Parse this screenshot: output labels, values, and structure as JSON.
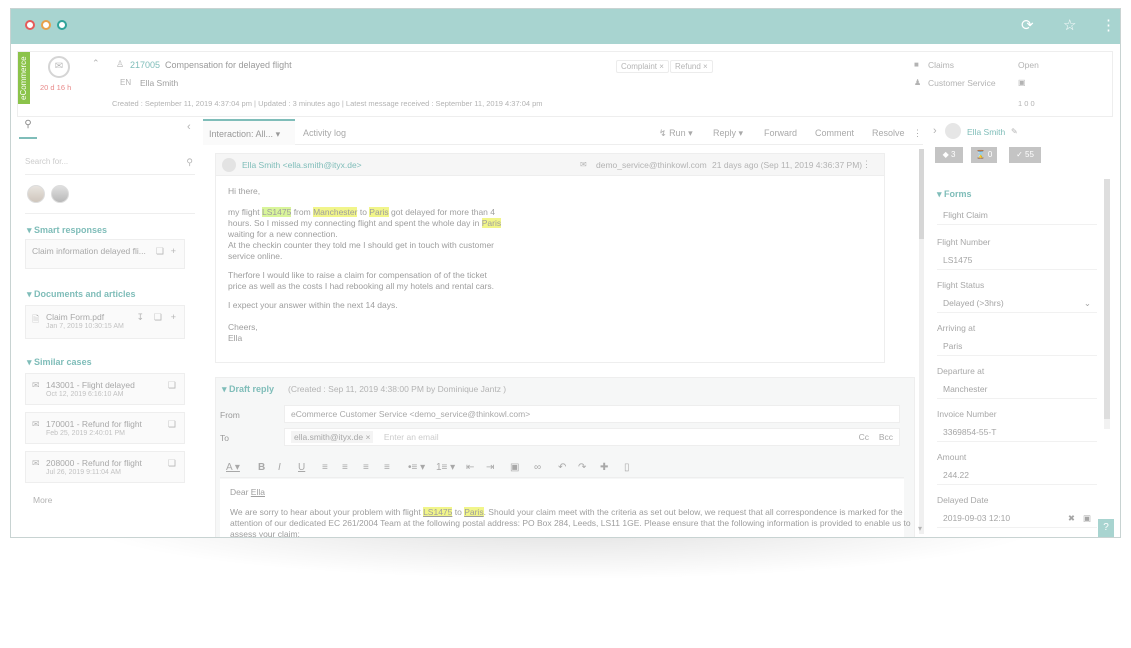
{
  "header": {
    "ecommerce_label": "eCommerce",
    "sla_time": "20 d 16 h",
    "case_id": "217005",
    "case_title": "Compensation for delayed flight",
    "lang": "EN",
    "customer": "Ella Smith",
    "tags": [
      "Complaint",
      "Refund"
    ],
    "meta": "Created : September 11, 2019 4:37:04 pm  |  Updated : 3 minutes ago  |  Latest message received : September 11, 2019 4:37:04 pm",
    "category": "Claims",
    "team": "Customer Service",
    "status": "Open",
    "counts": "1  0  0"
  },
  "left": {
    "search_placeholder": "Search for...",
    "smart_title": "Smart responses",
    "smart_item": "Claim information delayed fli...",
    "docs_title": "Documents and articles",
    "doc_name": "Claim Form.pdf",
    "doc_date": "Jan 7, 2019 10:30:15 AM",
    "similar_title": "Similar cases",
    "cases": [
      {
        "title": "143001 - Flight delayed",
        "date": "Oct 12, 2019 6:16:10 AM"
      },
      {
        "title": "170001 - Refund for flight",
        "date": "Feb 25, 2019 2:40:01 PM"
      },
      {
        "title": "208000 - Refund for flight",
        "date": "Jul 26, 2019 9:11:04 AM"
      }
    ],
    "more": "More"
  },
  "center": {
    "tab_interaction": "Interaction: All...",
    "tab_activity": "Activity log",
    "actions": {
      "run": "Run",
      "reply": "Reply",
      "forward": "Forward",
      "comment": "Comment",
      "resolve": "Resolve"
    },
    "message": {
      "from": "Ella Smith <ella.smith@ityx.de>",
      "to": "demo_service@thinkowl.com",
      "time": "21 days ago (Sep 11, 2019 4:36:37 PM)",
      "greeting": "Hi there,",
      "p1_a": "my flight ",
      "p1_flight": "LS1475",
      "p1_b": " from ",
      "p1_from": "Manchester",
      "p1_c": " to ",
      "p1_to": "Paris",
      "p1_d": " got delayed for more than 4",
      "p1_e": "hours. So I missed my connecting flight and spent the whole day in ",
      "p1_to2": "Paris",
      "p1_f": "waiting for a new connection.",
      "p1_g": "At the checkin counter they told me I should get in touch with customer",
      "p1_h": "service online.",
      "p2_a": "Therfore I would like to raise a claim for compensation of of the ticket",
      "p2_b": "price as well as the costs I had rebooking all my hotels and rental cars.",
      "p3": "I expect your answer within the next 14 days.",
      "closing": "Cheers,",
      "sign": "Ella"
    },
    "draft": {
      "title": "Draft reply",
      "meta": "(Created : Sep 11, 2019 4:38:00 PM by Dominique Jantz )",
      "from_label": "From",
      "from_value": "eCommerce Customer Service <demo_service@thinkowl.com>",
      "to_label": "To",
      "to_chip": "ella.smith@ityx.de",
      "to_placeholder": "Enter an email",
      "cc": "Cc",
      "bcc": "Bcc",
      "dear": "Dear ",
      "dear_name": "Ella",
      "line1_a": "We are sorry to hear about your problem with flight ",
      "line1_flight": "LS1475",
      "line1_b": " to ",
      "line1_to": "Paris",
      "line1_c": ". Should your claim meet with the criteria as set out below, we request that all correspondence is marked for the",
      "line2": "attention of our dedicated EC 261/2004 Team at the following postal address: PO Box 284, Leeds, LS11 1GE. Please ensure that the following information is provided to enable us to",
      "line3": "assess your claim:"
    }
  },
  "right": {
    "contact": "Ella Smith",
    "badges": [
      "3",
      "0",
      "55"
    ],
    "forms_title": "Forms",
    "form_name": "Flight Claim",
    "fields": [
      {
        "label": "Flight Number",
        "value": "LS1475"
      },
      {
        "label": "Flight Status",
        "value": "Delayed (>3hrs)"
      },
      {
        "label": "Arriving at",
        "value": "Paris"
      },
      {
        "label": "Departure at",
        "value": "Manchester"
      },
      {
        "label": "Invoice Number",
        "value": "3369854-55-T"
      },
      {
        "label": "Amount",
        "value": "244.22"
      },
      {
        "label": "Delayed Date",
        "value": "2019-09-03 12:10"
      }
    ],
    "help": "?"
  }
}
